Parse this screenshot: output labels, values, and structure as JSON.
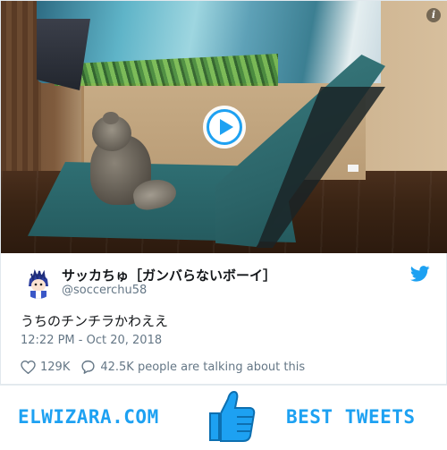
{
  "media": {
    "info_label": "i",
    "play_label": "play-video"
  },
  "tweet": {
    "display_name": "サッカちゅ［ガンバらないボーイ］",
    "handle": "@soccerchu58",
    "text": "うちのチンチラかわええ",
    "timestamp": "12:22 PM - Oct 20, 2018",
    "likes": "129K",
    "talking": "42.5K people are talking about this"
  },
  "banner": {
    "left_text": "ELWIZARA.COM",
    "right_text": "BEST TWEETS"
  },
  "colors": {
    "accent": "#1da1f2",
    "text": "#14171a",
    "muted": "#657786"
  }
}
